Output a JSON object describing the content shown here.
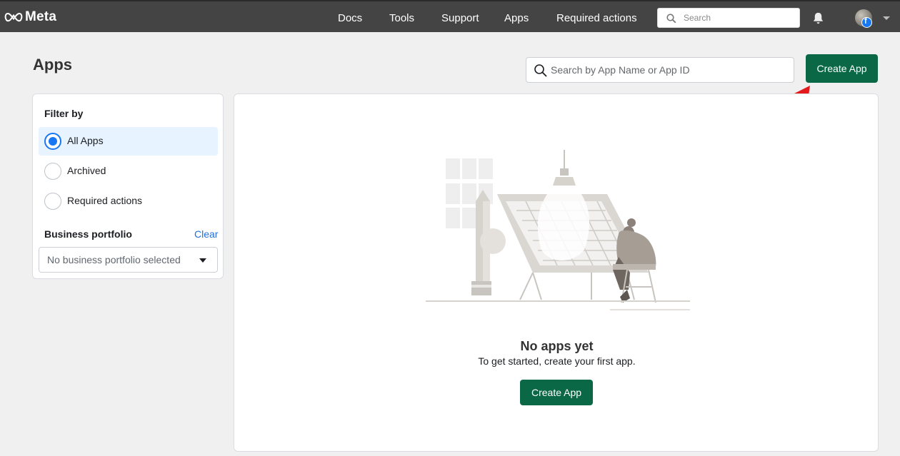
{
  "brand": {
    "name": "Meta"
  },
  "nav": {
    "items": [
      "Docs",
      "Tools",
      "Support",
      "Apps",
      "Required actions"
    ],
    "search_placeholder": "Search"
  },
  "page": {
    "title": "Apps",
    "search_placeholder": "Search by App Name or App ID",
    "create_button": "Create App"
  },
  "filter": {
    "title": "Filter by",
    "options": [
      {
        "label": "All Apps",
        "selected": true
      },
      {
        "label": "Archived",
        "selected": false
      },
      {
        "label": "Required actions",
        "selected": false
      }
    ],
    "business_portfolio": {
      "title": "Business portfolio",
      "clear_label": "Clear",
      "selected_value": "No business portfolio selected"
    }
  },
  "empty_state": {
    "title": "No apps yet",
    "subtitle": "To get started, create your first app.",
    "button": "Create App"
  },
  "colors": {
    "topbar": "#444444",
    "primary_green": "#0a6847",
    "selected_bg": "#e7f3ff",
    "radio_blue": "#1877f2",
    "link_blue": "#216fdb",
    "annotation_arrow": "#e3191b"
  }
}
